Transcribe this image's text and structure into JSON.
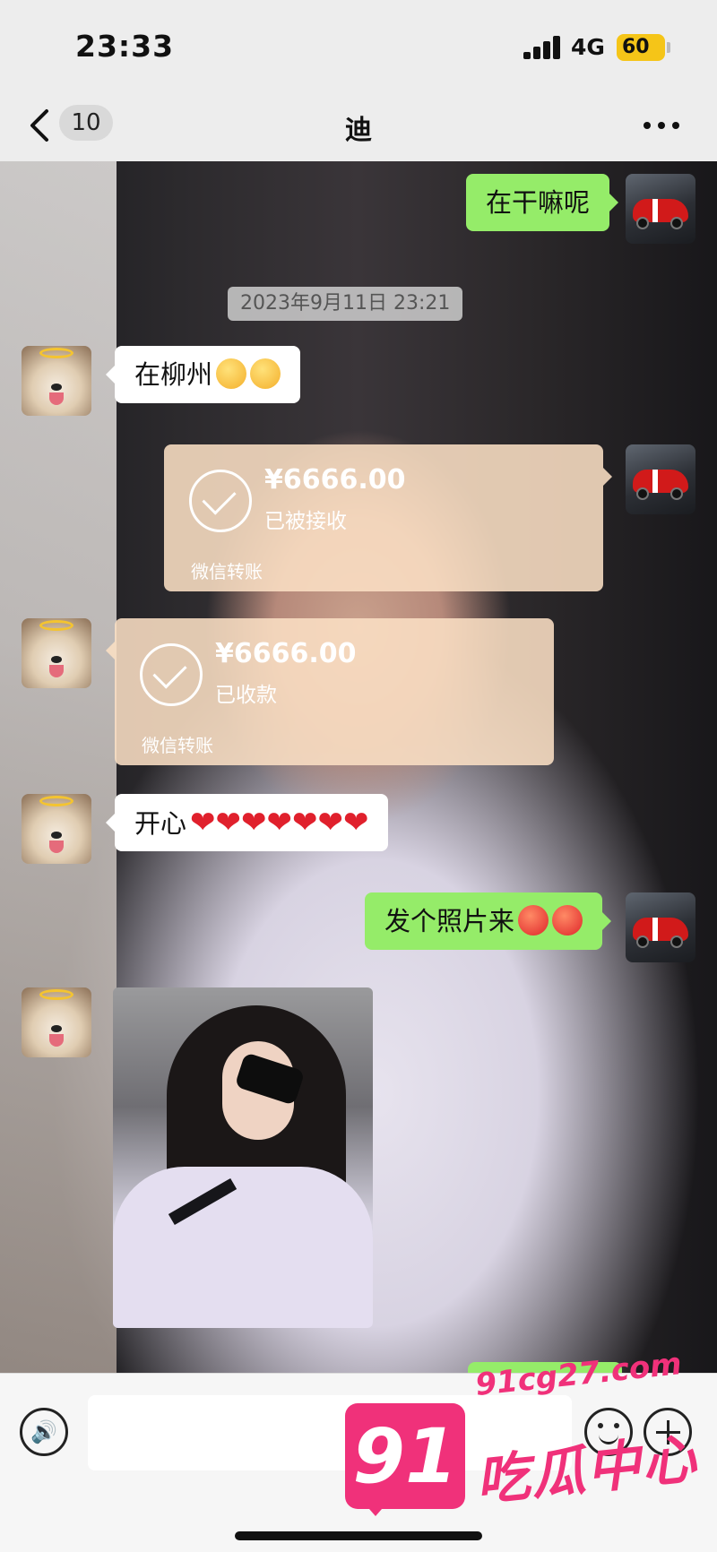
{
  "status_bar": {
    "time": "23:33",
    "network": "4G",
    "battery": "60"
  },
  "header": {
    "back_count": "10",
    "title": "迪"
  },
  "chat": {
    "timestamp": "2023年9月11日 23:21",
    "messages": [
      {
        "sender": "me",
        "type": "text",
        "text": "在干嘛呢"
      },
      {
        "sender": "other",
        "type": "text",
        "text": "在柳州",
        "emoji": [
          "thinking-face",
          "thinking-face"
        ]
      },
      {
        "sender": "me",
        "type": "transfer",
        "amount": "¥6666.00",
        "status": "已被接收",
        "label": "微信转账"
      },
      {
        "sender": "other",
        "type": "transfer",
        "amount": "¥6666.00",
        "status": "已收款",
        "label": "微信转账"
      },
      {
        "sender": "other",
        "type": "text",
        "text": "开心",
        "hearts": "❤❤❤❤❤❤❤"
      },
      {
        "sender": "me",
        "type": "text",
        "text": "发个照片来",
        "emoji": [
          "angry-face",
          "angry-face"
        ]
      },
      {
        "sender": "other",
        "type": "image"
      }
    ]
  },
  "input": {
    "voice_label": "🔊",
    "placeholder": ""
  },
  "watermark": {
    "badge": "91",
    "site": "91cg27.com",
    "text": "吃瓜中心"
  },
  "colors": {
    "me_bubble": "#95ec69",
    "other_bubble": "#ffffff",
    "transfer_card": "#fadfc4",
    "watermark": "#f0317a"
  }
}
